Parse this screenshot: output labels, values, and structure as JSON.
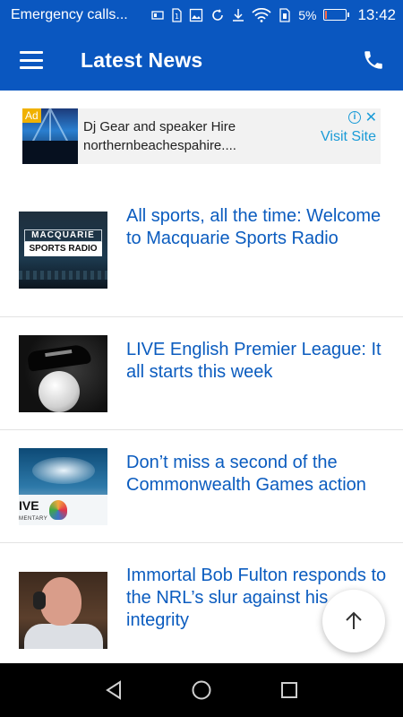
{
  "status_bar": {
    "notification_text": "Emergency calls...",
    "battery_percent": "5%",
    "battery_level": 0.05,
    "time": "13:42",
    "icons": [
      "sim-card-icon",
      "image-icon",
      "sync-icon",
      "download-icon",
      "wifi-icon",
      "sim-slot-icon",
      "battery-icon"
    ]
  },
  "app_bar": {
    "title": "Latest News",
    "menu_icon": "menu-icon",
    "call_icon": "phone-icon"
  },
  "ad": {
    "badge": "Ad",
    "title": "Dj Gear and speaker Hire",
    "url": "northernbeachespahire....",
    "cta": "Visit Site",
    "info_glyph": "i",
    "close_glyph": "✕"
  },
  "news": [
    {
      "title": "All sports, all the time: Welcome to Macquarie Sports Radio",
      "thumb_text_1": "MACQUARIE",
      "thumb_text_2": "SPORTS RADIO"
    },
    {
      "title": "LIVE English Premier League: It all starts this week"
    },
    {
      "title": "Don’t miss a second of the Commonwealth Games action",
      "thumb_text_1": "IVE",
      "thumb_text_2": "MENTARY"
    },
    {
      "title": "Immortal Bob Fulton responds to the NRL’s slur against his integrity"
    }
  ],
  "colors": {
    "primary": "#0a57c0",
    "link": "#0b5cbf",
    "ad_accent": "#1a9bd7",
    "ad_badge": "#f0b100"
  }
}
